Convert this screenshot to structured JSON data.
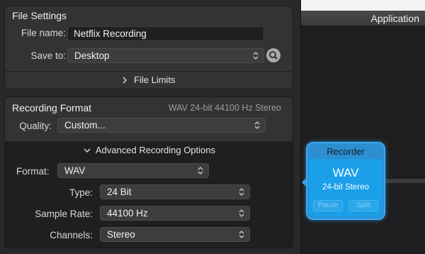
{
  "app": {
    "title": "Application"
  },
  "file_settings": {
    "title": "File Settings",
    "file_name_label": "File name:",
    "file_name_value": "Netflix Recording",
    "save_to_label": "Save to:",
    "save_to_value": "Desktop",
    "file_limits_label": "File Limits"
  },
  "recording_format": {
    "title": "Recording Format",
    "summary": "WAV 24-bit 44100 Hz Stereo",
    "quality_label": "Quality:",
    "quality_value": "Custom...",
    "advanced_label": "Advanced Recording Options",
    "format_label": "Format:",
    "format_value": "WAV",
    "type_label": "Type:",
    "type_value": "24 Bit",
    "sample_rate_label": "Sample Rate:",
    "sample_rate_value": "44100 Hz",
    "channels_label": "Channels:",
    "channels_value": "Stereo"
  },
  "recorder": {
    "title": "Recorder",
    "format": "WAV",
    "detail": "24-bit Stereo",
    "pause_label": "Pause",
    "split_label": "Split"
  },
  "colors": {
    "accent": "#1a9fe8",
    "accent_border": "#3aa9ef",
    "panel": "#333335",
    "background": "#232325"
  }
}
